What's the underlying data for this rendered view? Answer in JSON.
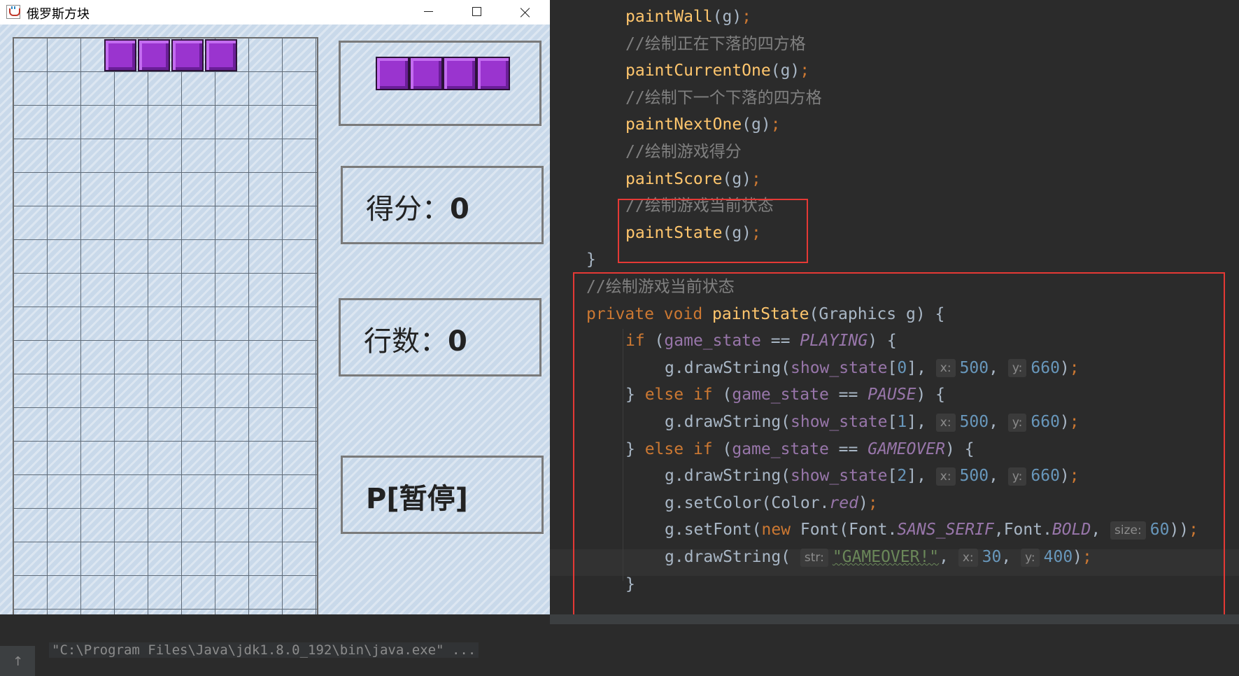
{
  "window": {
    "title": "俄罗斯方块"
  },
  "game": {
    "next_label": "",
    "score_text": "得分：",
    "score_value": "0",
    "lines_text": "行数：",
    "lines_value": "0",
    "state_text": "P[暂停]",
    "block_color": "#9a34cf"
  },
  "editor": {
    "lines": [
      {
        "indent": 1,
        "segments": [
          {
            "t": "paintWall",
            "c": "fn"
          },
          {
            "t": "(g)"
          },
          {
            "t": ";",
            "c": "kw"
          }
        ]
      },
      {
        "indent": 1,
        "segments": [
          {
            "t": "//绘制正在下落的四方格",
            "c": "cmt"
          }
        ]
      },
      {
        "indent": 1,
        "segments": [
          {
            "t": "paintCurrentOne",
            "c": "fn"
          },
          {
            "t": "(g)"
          },
          {
            "t": ";",
            "c": "kw"
          }
        ]
      },
      {
        "indent": 1,
        "segments": [
          {
            "t": "//绘制下一个下落的四方格",
            "c": "cmt"
          }
        ]
      },
      {
        "indent": 1,
        "segments": [
          {
            "t": "paintNextOne",
            "c": "fn"
          },
          {
            "t": "(g)"
          },
          {
            "t": ";",
            "c": "kw"
          }
        ]
      },
      {
        "indent": 1,
        "segments": [
          {
            "t": "//绘制游戏得分",
            "c": "cmt"
          }
        ]
      },
      {
        "indent": 1,
        "segments": [
          {
            "t": "paintScore",
            "c": "fn"
          },
          {
            "t": "(g)"
          },
          {
            "t": ";",
            "c": "kw"
          }
        ]
      },
      {
        "indent": 1,
        "segments": [
          {
            "t": "//绘制游戏当前状态",
            "c": "cmt"
          }
        ]
      },
      {
        "indent": 1,
        "segments": [
          {
            "t": "paintState",
            "c": "fn"
          },
          {
            "t": "(g)"
          },
          {
            "t": ";",
            "c": "kw"
          }
        ]
      },
      {
        "indent": 0,
        "segments": [
          {
            "t": "}"
          }
        ]
      },
      {
        "indent": 0,
        "segments": [
          {
            "t": "//绘制游戏当前状态",
            "c": "cmt"
          }
        ]
      },
      {
        "indent": 0,
        "segments": [
          {
            "t": "private ",
            "c": "kw"
          },
          {
            "t": "void ",
            "c": "kw"
          },
          {
            "t": "paintState",
            "c": "fn"
          },
          {
            "t": "(Graphics g) {"
          }
        ]
      },
      {
        "indent": 1,
        "segments": [
          {
            "t": "if ",
            "c": "kw"
          },
          {
            "t": "("
          },
          {
            "t": "game_state",
            "c": "field"
          },
          {
            "t": " == "
          },
          {
            "t": "PLAYING",
            "c": "const"
          },
          {
            "t": ") {"
          }
        ]
      },
      {
        "indent": 2,
        "segments": [
          {
            "t": "g.drawString("
          },
          {
            "t": "show_state",
            "c": "field"
          },
          {
            "t": "["
          },
          {
            "t": "0",
            "c": "num"
          },
          {
            "t": "], "
          },
          {
            "t": "x:",
            "c": "hint"
          },
          {
            "t": "500",
            "c": "num"
          },
          {
            "t": ", "
          },
          {
            "t": "y:",
            "c": "hint"
          },
          {
            "t": "660",
            "c": "num"
          },
          {
            "t": ")"
          },
          {
            "t": ";",
            "c": "kw"
          }
        ]
      },
      {
        "indent": 1,
        "segments": [
          {
            "t": "} "
          },
          {
            "t": "else if ",
            "c": "kw"
          },
          {
            "t": "("
          },
          {
            "t": "game_state",
            "c": "field"
          },
          {
            "t": " == "
          },
          {
            "t": "PAUSE",
            "c": "const"
          },
          {
            "t": ") {"
          }
        ]
      },
      {
        "indent": 2,
        "segments": [
          {
            "t": "g.drawString("
          },
          {
            "t": "show_state",
            "c": "field"
          },
          {
            "t": "["
          },
          {
            "t": "1",
            "c": "num"
          },
          {
            "t": "], "
          },
          {
            "t": "x:",
            "c": "hint"
          },
          {
            "t": "500",
            "c": "num"
          },
          {
            "t": ", "
          },
          {
            "t": "y:",
            "c": "hint"
          },
          {
            "t": "660",
            "c": "num"
          },
          {
            "t": ")"
          },
          {
            "t": ";",
            "c": "kw"
          }
        ]
      },
      {
        "indent": 1,
        "segments": [
          {
            "t": "} "
          },
          {
            "t": "else if ",
            "c": "kw"
          },
          {
            "t": "("
          },
          {
            "t": "game_state",
            "c": "field"
          },
          {
            "t": " == "
          },
          {
            "t": "GAMEOVER",
            "c": "const"
          },
          {
            "t": ") {"
          }
        ]
      },
      {
        "indent": 2,
        "segments": [
          {
            "t": "g.drawString("
          },
          {
            "t": "show_state",
            "c": "field"
          },
          {
            "t": "["
          },
          {
            "t": "2",
            "c": "num"
          },
          {
            "t": "], "
          },
          {
            "t": "x:",
            "c": "hint"
          },
          {
            "t": "500",
            "c": "num"
          },
          {
            "t": ", "
          },
          {
            "t": "y:",
            "c": "hint"
          },
          {
            "t": "660",
            "c": "num"
          },
          {
            "t": ")"
          },
          {
            "t": ";",
            "c": "kw"
          }
        ]
      },
      {
        "indent": 2,
        "segments": [
          {
            "t": "g.setColor(Color."
          },
          {
            "t": "red",
            "c": "const"
          },
          {
            "t": ")"
          },
          {
            "t": ";",
            "c": "kw"
          }
        ]
      },
      {
        "indent": 2,
        "segments": [
          {
            "t": "g.setFont("
          },
          {
            "t": "new ",
            "c": "kw"
          },
          {
            "t": "Font(Font."
          },
          {
            "t": "SANS_SERIF",
            "c": "const"
          },
          {
            "t": ",Font."
          },
          {
            "t": "BOLD",
            "c": "const"
          },
          {
            "t": ", "
          },
          {
            "t": "size:",
            "c": "hint"
          },
          {
            "t": "60",
            "c": "num"
          },
          {
            "t": "))"
          },
          {
            "t": ";",
            "c": "kw"
          }
        ]
      },
      {
        "indent": 2,
        "segments": [
          {
            "t": "g.drawString( "
          },
          {
            "t": "str:",
            "c": "hint"
          },
          {
            "t": "\"GAMEOVER!\"",
            "c": "str"
          },
          {
            "t": ", "
          },
          {
            "t": "x:",
            "c": "hint"
          },
          {
            "t": "30",
            "c": "num"
          },
          {
            "t": ", "
          },
          {
            "t": "y:",
            "c": "hint"
          },
          {
            "t": "400",
            "c": "num"
          },
          {
            "t": ")"
          },
          {
            "t": ";",
            "c": "kw"
          }
        ]
      },
      {
        "indent": 1,
        "segments": [
          {
            "t": "}"
          }
        ]
      }
    ]
  },
  "console": {
    "command": "\"C:\\Program Files\\Java\\jdk1.8.0_192\\bin\\java.exe\" ..."
  }
}
